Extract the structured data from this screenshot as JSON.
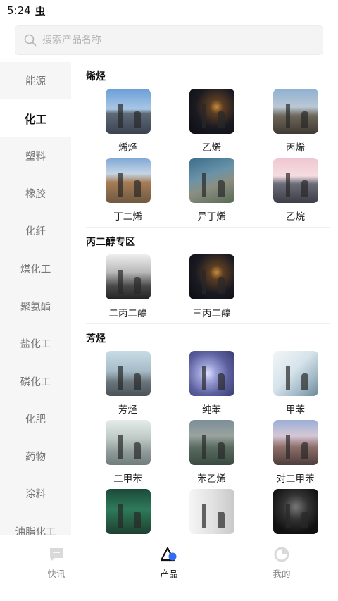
{
  "status_bar": {
    "time": "5:24",
    "notification_icon": "虫"
  },
  "search": {
    "placeholder": "搜索产品名称"
  },
  "sidebar": {
    "items": [
      {
        "label": "能源",
        "active": false
      },
      {
        "label": "化工",
        "active": true
      },
      {
        "label": "塑料",
        "active": false
      },
      {
        "label": "橡胶",
        "active": false
      },
      {
        "label": "化纤",
        "active": false
      },
      {
        "label": "煤化工",
        "active": false
      },
      {
        "label": "聚氨酯",
        "active": false
      },
      {
        "label": "盐化工",
        "active": false
      },
      {
        "label": "磷化工",
        "active": false
      },
      {
        "label": "化肥",
        "active": false
      },
      {
        "label": "药物",
        "active": false
      },
      {
        "label": "涂料",
        "active": false
      },
      {
        "label": "油脂化工",
        "active": false
      }
    ]
  },
  "sections": [
    {
      "title": "烯烃",
      "products": [
        {
          "label": "烯烃",
          "image": "t-sky"
        },
        {
          "label": "乙烯",
          "image": "t-night"
        },
        {
          "label": "丙烯",
          "image": "t-dusk"
        },
        {
          "label": "丁二烯",
          "image": "t-town"
        },
        {
          "label": "异丁烯",
          "image": "t-aerial"
        },
        {
          "label": "乙烷",
          "image": "t-pink"
        }
      ]
    },
    {
      "title": "丙二醇专区",
      "products": [
        {
          "label": "二丙二醇",
          "image": "t-steel"
        },
        {
          "label": "三丙二醇",
          "image": "t-night"
        }
      ]
    },
    {
      "title": "芳烃",
      "products": [
        {
          "label": "芳烃",
          "image": "t-pale"
        },
        {
          "label": "纯苯",
          "image": "t-purple"
        },
        {
          "label": "甲苯",
          "image": "t-lab"
        },
        {
          "label": "二甲苯",
          "image": "t-glass"
        },
        {
          "label": "苯乙烯",
          "image": "t-plant"
        },
        {
          "label": "对二甲苯",
          "image": "t-city"
        },
        {
          "label": "",
          "image": "t-green"
        },
        {
          "label": "",
          "image": "t-bottle"
        },
        {
          "label": "",
          "image": "t-dark"
        }
      ]
    }
  ],
  "tabbar": {
    "items": [
      {
        "label": "快讯",
        "icon": "chat-icon",
        "active": false
      },
      {
        "label": "产品",
        "icon": "triangle-product-icon",
        "active": true
      },
      {
        "label": "我的",
        "icon": "profile-ring-icon",
        "active": false
      }
    ],
    "accent_color": "#2f6df6"
  }
}
